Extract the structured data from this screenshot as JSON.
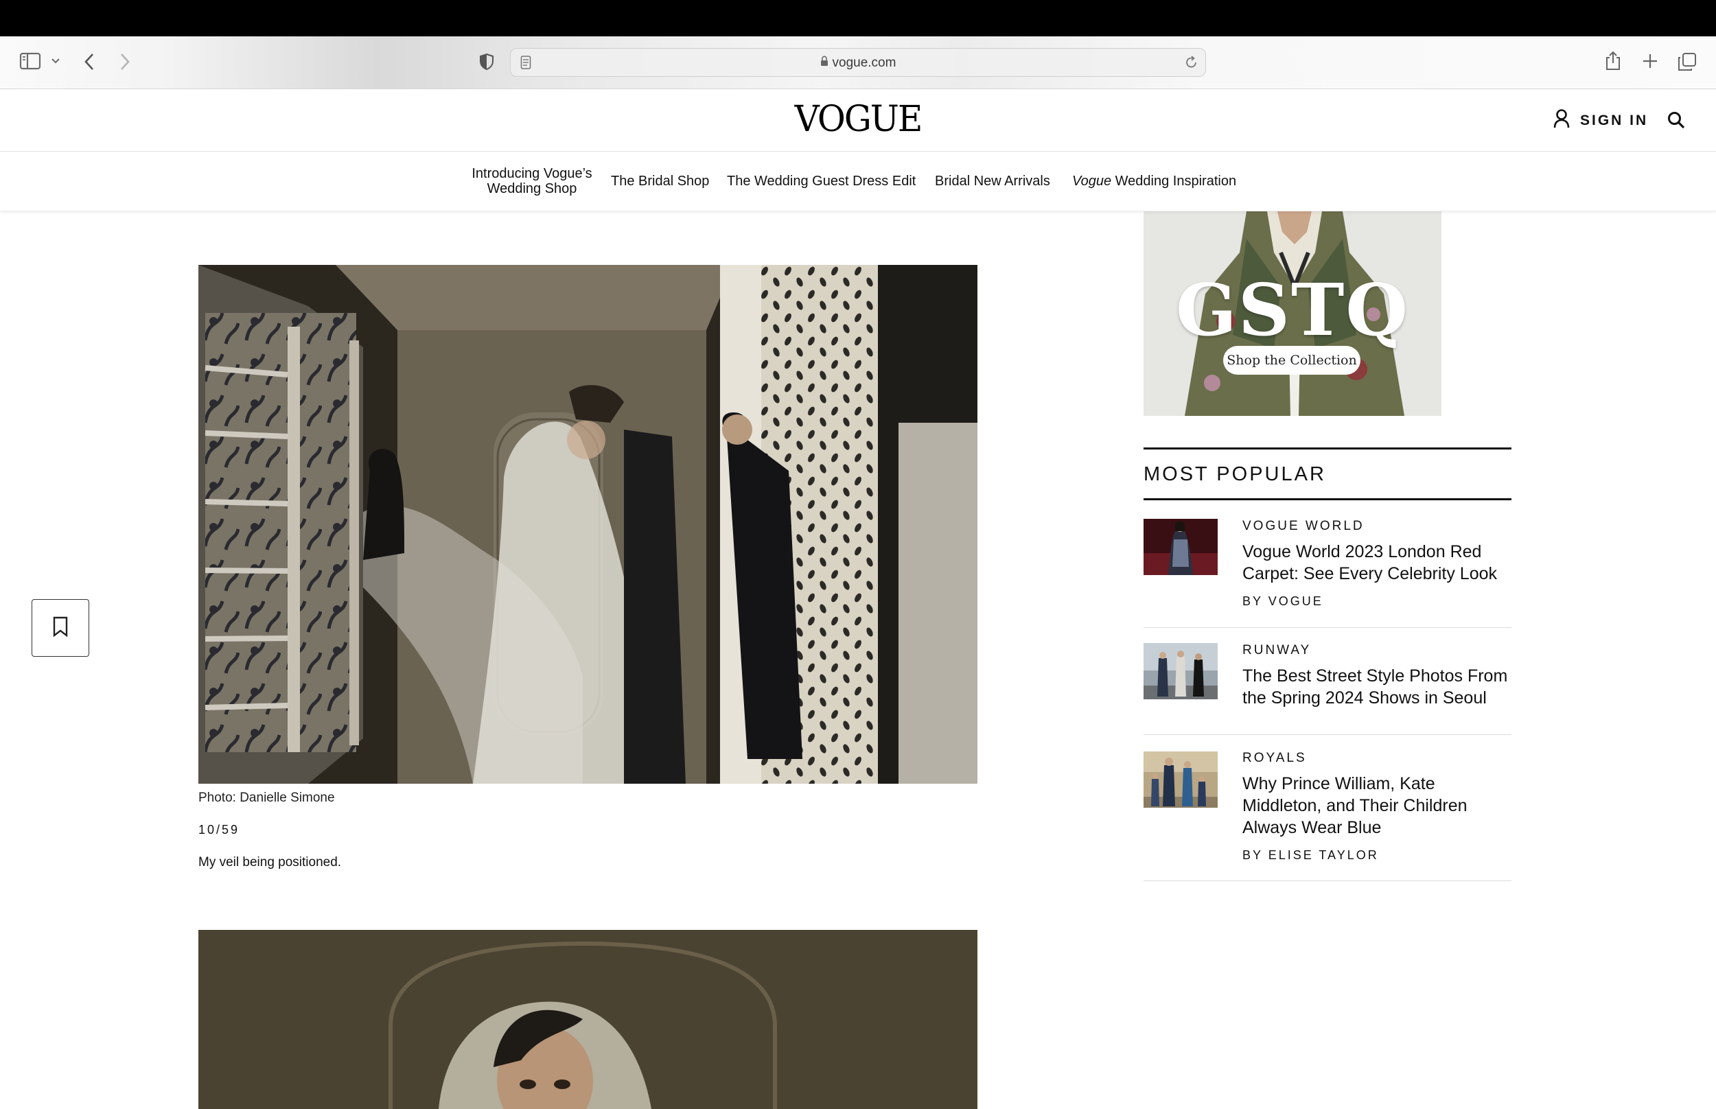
{
  "browser": {
    "url": "vogue.com"
  },
  "site": {
    "logo": "VOGUE",
    "sign_in": "SIGN IN"
  },
  "nav": {
    "items": [
      {
        "label": "Introducing Vogue’s Wedding Shop"
      },
      {
        "label": "The Bridal Shop"
      },
      {
        "label": "The Wedding Guest Dress Edit"
      },
      {
        "label": "Bridal New Arrivals"
      },
      {
        "italic": "Vogue",
        "label": "Wedding Inspiration"
      }
    ]
  },
  "slide": {
    "credit": "Photo: Danielle Simone",
    "counter": "10/59",
    "caption": "My veil being positioned."
  },
  "ad": {
    "brand": "GSTQ",
    "cta": "Shop the Collection"
  },
  "most_popular": {
    "heading": "MOST POPULAR",
    "items": [
      {
        "rubric": "VOGUE WORLD",
        "title": "Vogue World 2023 London Red Carpet: See Every Celebrity Look",
        "byline": "BY VOGUE"
      },
      {
        "rubric": "RUNWAY",
        "title": "The Best Street Style Photos From the Spring 2024 Shows in Seoul",
        "byline": ""
      },
      {
        "rubric": "ROYALS",
        "title": "Why Prince William, Kate Middleton, and Their Children Always Wear Blue",
        "byline": "BY ELISE TAYLOR"
      }
    ]
  },
  "icons": [
    "sidebar-icon",
    "chevron-down-icon",
    "back-icon",
    "forward-icon",
    "shield-icon",
    "reader-icon",
    "lock-icon",
    "reload-icon",
    "share-icon",
    "new-tab-icon",
    "tabs-icon",
    "user-icon",
    "search-icon",
    "bookmark-icon"
  ]
}
